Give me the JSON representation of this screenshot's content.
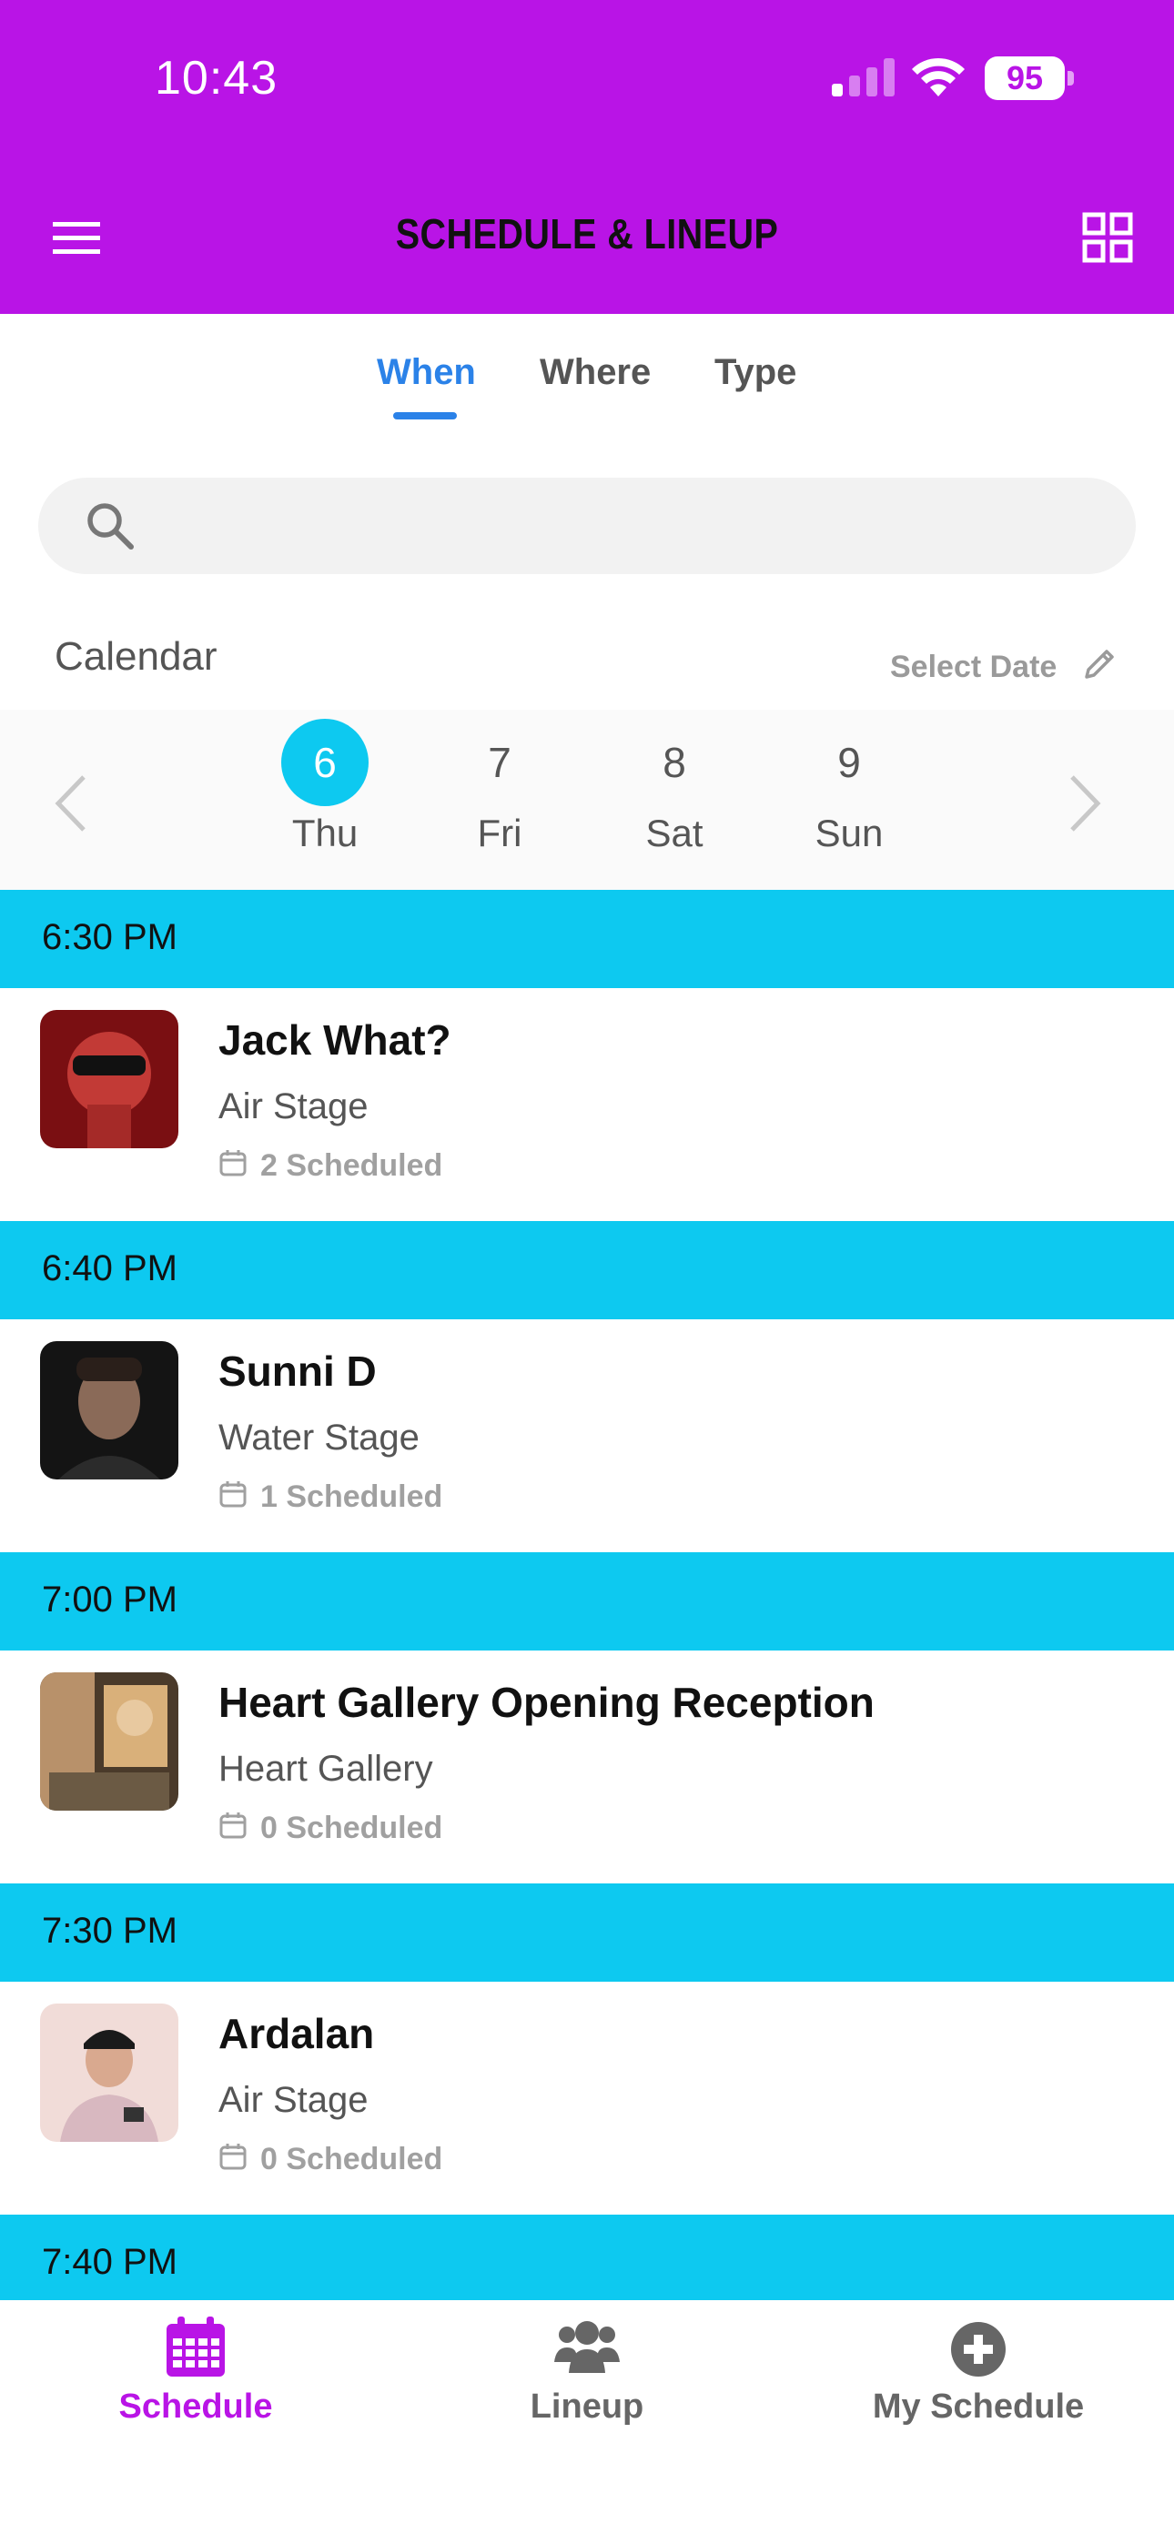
{
  "status_bar": {
    "time": "10:43",
    "battery": "95"
  },
  "header": {
    "title": "SCHEDULE & LINEUP",
    "menu_icon": "hamburger-menu-icon",
    "grid_icon": "grid-view-icon",
    "background": "#b914e6"
  },
  "tabs": [
    {
      "label": "When",
      "active": true
    },
    {
      "label": "Where",
      "active": false
    },
    {
      "label": "Type",
      "active": false
    }
  ],
  "search": {
    "placeholder": "",
    "value": ""
  },
  "calendar": {
    "label": "Calendar",
    "select_date": "Select Date",
    "days": [
      {
        "num": "6",
        "name": "Thu",
        "selected": true
      },
      {
        "num": "7",
        "name": "Fri",
        "selected": false
      },
      {
        "num": "8",
        "name": "Sat",
        "selected": false
      },
      {
        "num": "9",
        "name": "Sun",
        "selected": false
      }
    ]
  },
  "schedule": [
    {
      "time": "6:30 PM",
      "title": "Jack What?",
      "stage": "Air Stage",
      "scheduled": "2 Scheduled"
    },
    {
      "time": "6:40 PM",
      "title": "Sunni D",
      "stage": "Water Stage",
      "scheduled": "1 Scheduled"
    },
    {
      "time": "7:00 PM",
      "title": "Heart Gallery Opening Reception",
      "stage": "Heart Gallery",
      "scheduled": "0 Scheduled"
    },
    {
      "time": "7:30 PM",
      "title": "Ardalan",
      "stage": "Air Stage",
      "scheduled": "0 Scheduled"
    },
    {
      "time": "7:40 PM"
    }
  ],
  "bottom_nav": [
    {
      "label": "Schedule",
      "icon": "calendar-icon",
      "active": true
    },
    {
      "label": "Lineup",
      "icon": "people-icon",
      "active": false
    },
    {
      "label": "My Schedule",
      "icon": "plus-circle-icon",
      "active": false
    }
  ],
  "colors": {
    "accent": "#b914e6",
    "time_bar": "#0dc9f0",
    "tab_active": "#2b82e8"
  }
}
